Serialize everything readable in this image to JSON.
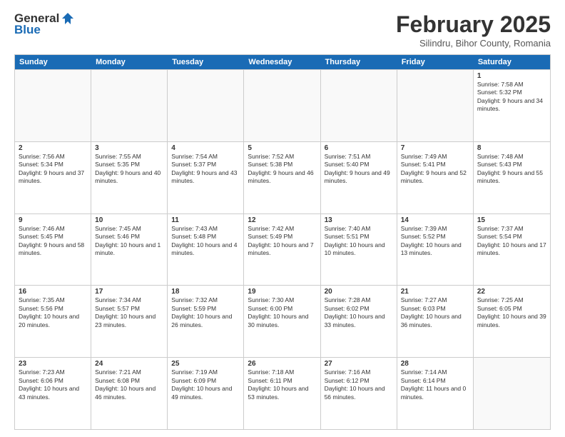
{
  "header": {
    "logo_general": "General",
    "logo_blue": "Blue",
    "month_title": "February 2025",
    "location": "Silindru, Bihor County, Romania"
  },
  "weekdays": [
    "Sunday",
    "Monday",
    "Tuesday",
    "Wednesday",
    "Thursday",
    "Friday",
    "Saturday"
  ],
  "rows": [
    [
      {
        "day": "",
        "info": ""
      },
      {
        "day": "",
        "info": ""
      },
      {
        "day": "",
        "info": ""
      },
      {
        "day": "",
        "info": ""
      },
      {
        "day": "",
        "info": ""
      },
      {
        "day": "",
        "info": ""
      },
      {
        "day": "1",
        "info": "Sunrise: 7:58 AM\nSunset: 5:32 PM\nDaylight: 9 hours and 34 minutes."
      }
    ],
    [
      {
        "day": "2",
        "info": "Sunrise: 7:56 AM\nSunset: 5:34 PM\nDaylight: 9 hours and 37 minutes."
      },
      {
        "day": "3",
        "info": "Sunrise: 7:55 AM\nSunset: 5:35 PM\nDaylight: 9 hours and 40 minutes."
      },
      {
        "day": "4",
        "info": "Sunrise: 7:54 AM\nSunset: 5:37 PM\nDaylight: 9 hours and 43 minutes."
      },
      {
        "day": "5",
        "info": "Sunrise: 7:52 AM\nSunset: 5:38 PM\nDaylight: 9 hours and 46 minutes."
      },
      {
        "day": "6",
        "info": "Sunrise: 7:51 AM\nSunset: 5:40 PM\nDaylight: 9 hours and 49 minutes."
      },
      {
        "day": "7",
        "info": "Sunrise: 7:49 AM\nSunset: 5:41 PM\nDaylight: 9 hours and 52 minutes."
      },
      {
        "day": "8",
        "info": "Sunrise: 7:48 AM\nSunset: 5:43 PM\nDaylight: 9 hours and 55 minutes."
      }
    ],
    [
      {
        "day": "9",
        "info": "Sunrise: 7:46 AM\nSunset: 5:45 PM\nDaylight: 9 hours and 58 minutes."
      },
      {
        "day": "10",
        "info": "Sunrise: 7:45 AM\nSunset: 5:46 PM\nDaylight: 10 hours and 1 minute."
      },
      {
        "day": "11",
        "info": "Sunrise: 7:43 AM\nSunset: 5:48 PM\nDaylight: 10 hours and 4 minutes."
      },
      {
        "day": "12",
        "info": "Sunrise: 7:42 AM\nSunset: 5:49 PM\nDaylight: 10 hours and 7 minutes."
      },
      {
        "day": "13",
        "info": "Sunrise: 7:40 AM\nSunset: 5:51 PM\nDaylight: 10 hours and 10 minutes."
      },
      {
        "day": "14",
        "info": "Sunrise: 7:39 AM\nSunset: 5:52 PM\nDaylight: 10 hours and 13 minutes."
      },
      {
        "day": "15",
        "info": "Sunrise: 7:37 AM\nSunset: 5:54 PM\nDaylight: 10 hours and 17 minutes."
      }
    ],
    [
      {
        "day": "16",
        "info": "Sunrise: 7:35 AM\nSunset: 5:56 PM\nDaylight: 10 hours and 20 minutes."
      },
      {
        "day": "17",
        "info": "Sunrise: 7:34 AM\nSunset: 5:57 PM\nDaylight: 10 hours and 23 minutes."
      },
      {
        "day": "18",
        "info": "Sunrise: 7:32 AM\nSunset: 5:59 PM\nDaylight: 10 hours and 26 minutes."
      },
      {
        "day": "19",
        "info": "Sunrise: 7:30 AM\nSunset: 6:00 PM\nDaylight: 10 hours and 30 minutes."
      },
      {
        "day": "20",
        "info": "Sunrise: 7:28 AM\nSunset: 6:02 PM\nDaylight: 10 hours and 33 minutes."
      },
      {
        "day": "21",
        "info": "Sunrise: 7:27 AM\nSunset: 6:03 PM\nDaylight: 10 hours and 36 minutes."
      },
      {
        "day": "22",
        "info": "Sunrise: 7:25 AM\nSunset: 6:05 PM\nDaylight: 10 hours and 39 minutes."
      }
    ],
    [
      {
        "day": "23",
        "info": "Sunrise: 7:23 AM\nSunset: 6:06 PM\nDaylight: 10 hours and 43 minutes."
      },
      {
        "day": "24",
        "info": "Sunrise: 7:21 AM\nSunset: 6:08 PM\nDaylight: 10 hours and 46 minutes."
      },
      {
        "day": "25",
        "info": "Sunrise: 7:19 AM\nSunset: 6:09 PM\nDaylight: 10 hours and 49 minutes."
      },
      {
        "day": "26",
        "info": "Sunrise: 7:18 AM\nSunset: 6:11 PM\nDaylight: 10 hours and 53 minutes."
      },
      {
        "day": "27",
        "info": "Sunrise: 7:16 AM\nSunset: 6:12 PM\nDaylight: 10 hours and 56 minutes."
      },
      {
        "day": "28",
        "info": "Sunrise: 7:14 AM\nSunset: 6:14 PM\nDaylight: 11 hours and 0 minutes."
      },
      {
        "day": "",
        "info": ""
      }
    ]
  ]
}
